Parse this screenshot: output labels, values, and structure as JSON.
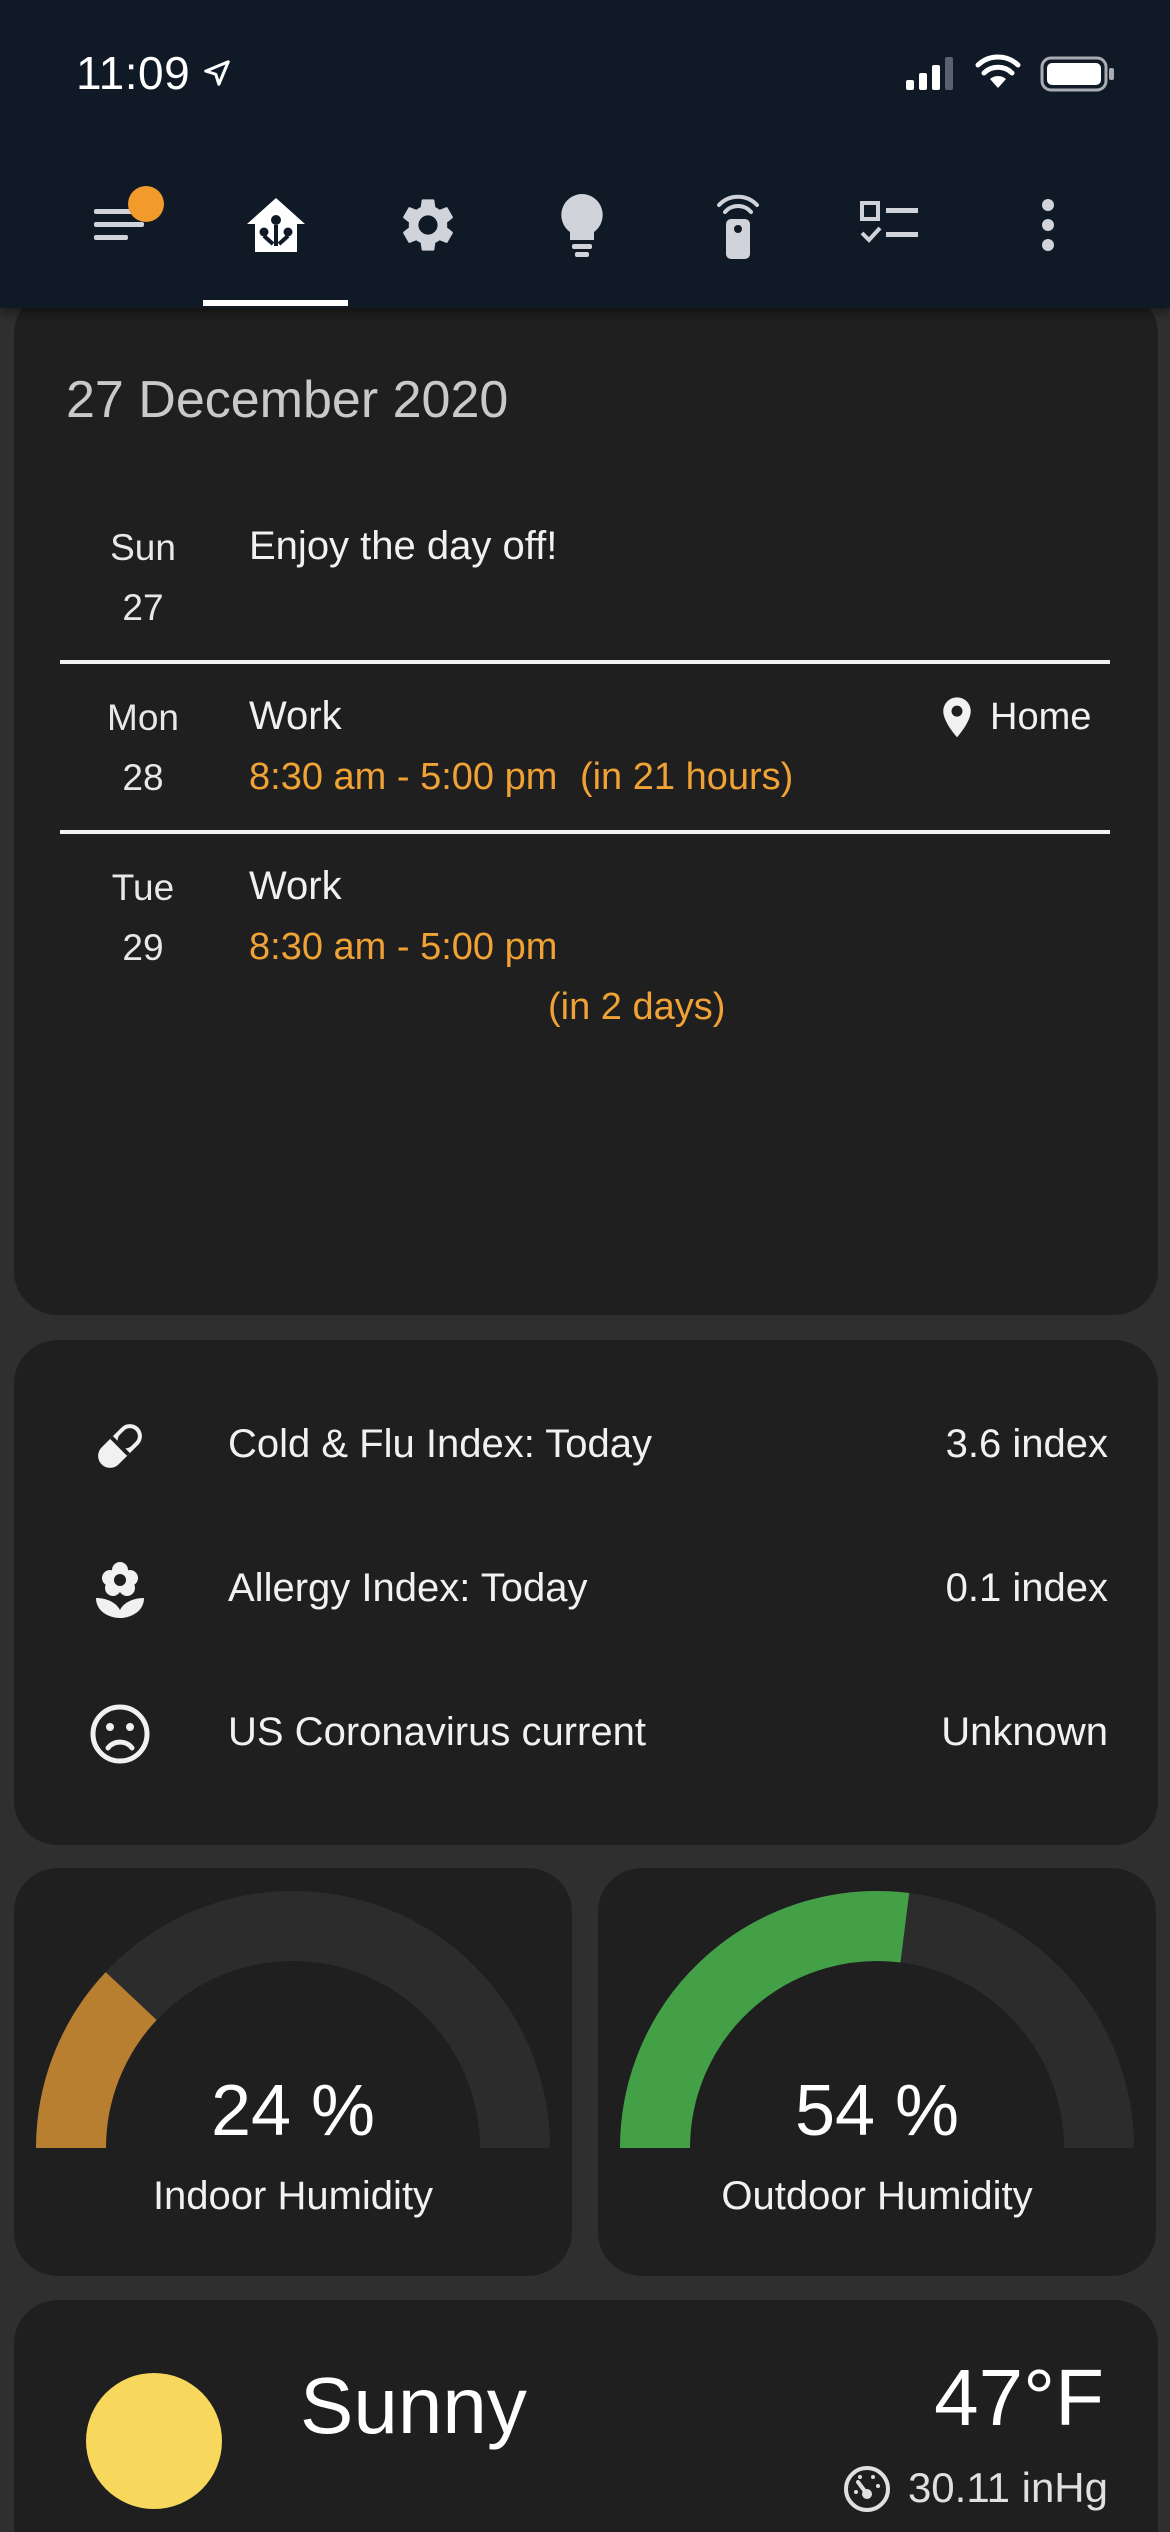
{
  "status_bar": {
    "time": "11:09"
  },
  "tabs": [
    {
      "name": "menu",
      "icon": "menu-icon"
    },
    {
      "name": "home",
      "icon": "home-automation-icon"
    },
    {
      "name": "settings",
      "icon": "gear-icon"
    },
    {
      "name": "lights",
      "icon": "lightbulb-icon"
    },
    {
      "name": "remote",
      "icon": "remote-icon"
    },
    {
      "name": "checklist",
      "icon": "checklist-icon"
    },
    {
      "name": "more",
      "icon": "more-vertical-icon"
    }
  ],
  "active_tab": "home",
  "colors": {
    "accent": "#f0a235",
    "header_bg": "#101a27",
    "card_bg": "#1f1f1f",
    "indoor_gauge": "#b87f30",
    "outdoor_gauge": "#43a047",
    "badge": "#f29a2c"
  },
  "calendar": {
    "date_title": "27 December 2020",
    "days": [
      {
        "dow": "Sun",
        "day": "27",
        "events": [
          {
            "title": "Enjoy the day off!"
          }
        ]
      },
      {
        "dow": "Mon",
        "day": "28",
        "events": [
          {
            "title": "Work",
            "time": "8:30 am - 5:00 pm",
            "relative": "(in 21 hours)",
            "location": "Home"
          }
        ]
      },
      {
        "dow": "Tue",
        "day": "29",
        "events": [
          {
            "title": "Work",
            "time": "8:30 am - 5:00 pm",
            "relative": "(in 2 days)"
          }
        ]
      }
    ]
  },
  "sensors": [
    {
      "icon": "pill-icon",
      "label": "Cold & Flu Index: Today",
      "value": "3.6 index"
    },
    {
      "icon": "flower-icon",
      "label": "Allergy Index: Today",
      "value": "0.1 index"
    },
    {
      "icon": "sad-face-icon",
      "label": "US Coronavirus current",
      "value": "Unknown"
    }
  ],
  "gauges": [
    {
      "name": "Indoor Humidity",
      "value_text": "24 %",
      "value": 24,
      "color": "#b87f30"
    },
    {
      "name": "Outdoor Humidity",
      "value_text": "54 %",
      "value": 54,
      "color": "#43a047"
    }
  ],
  "weather": {
    "condition": "Sunny",
    "temperature": "47°F",
    "pressure": "30.11 inHg",
    "icon": "sun-icon"
  }
}
